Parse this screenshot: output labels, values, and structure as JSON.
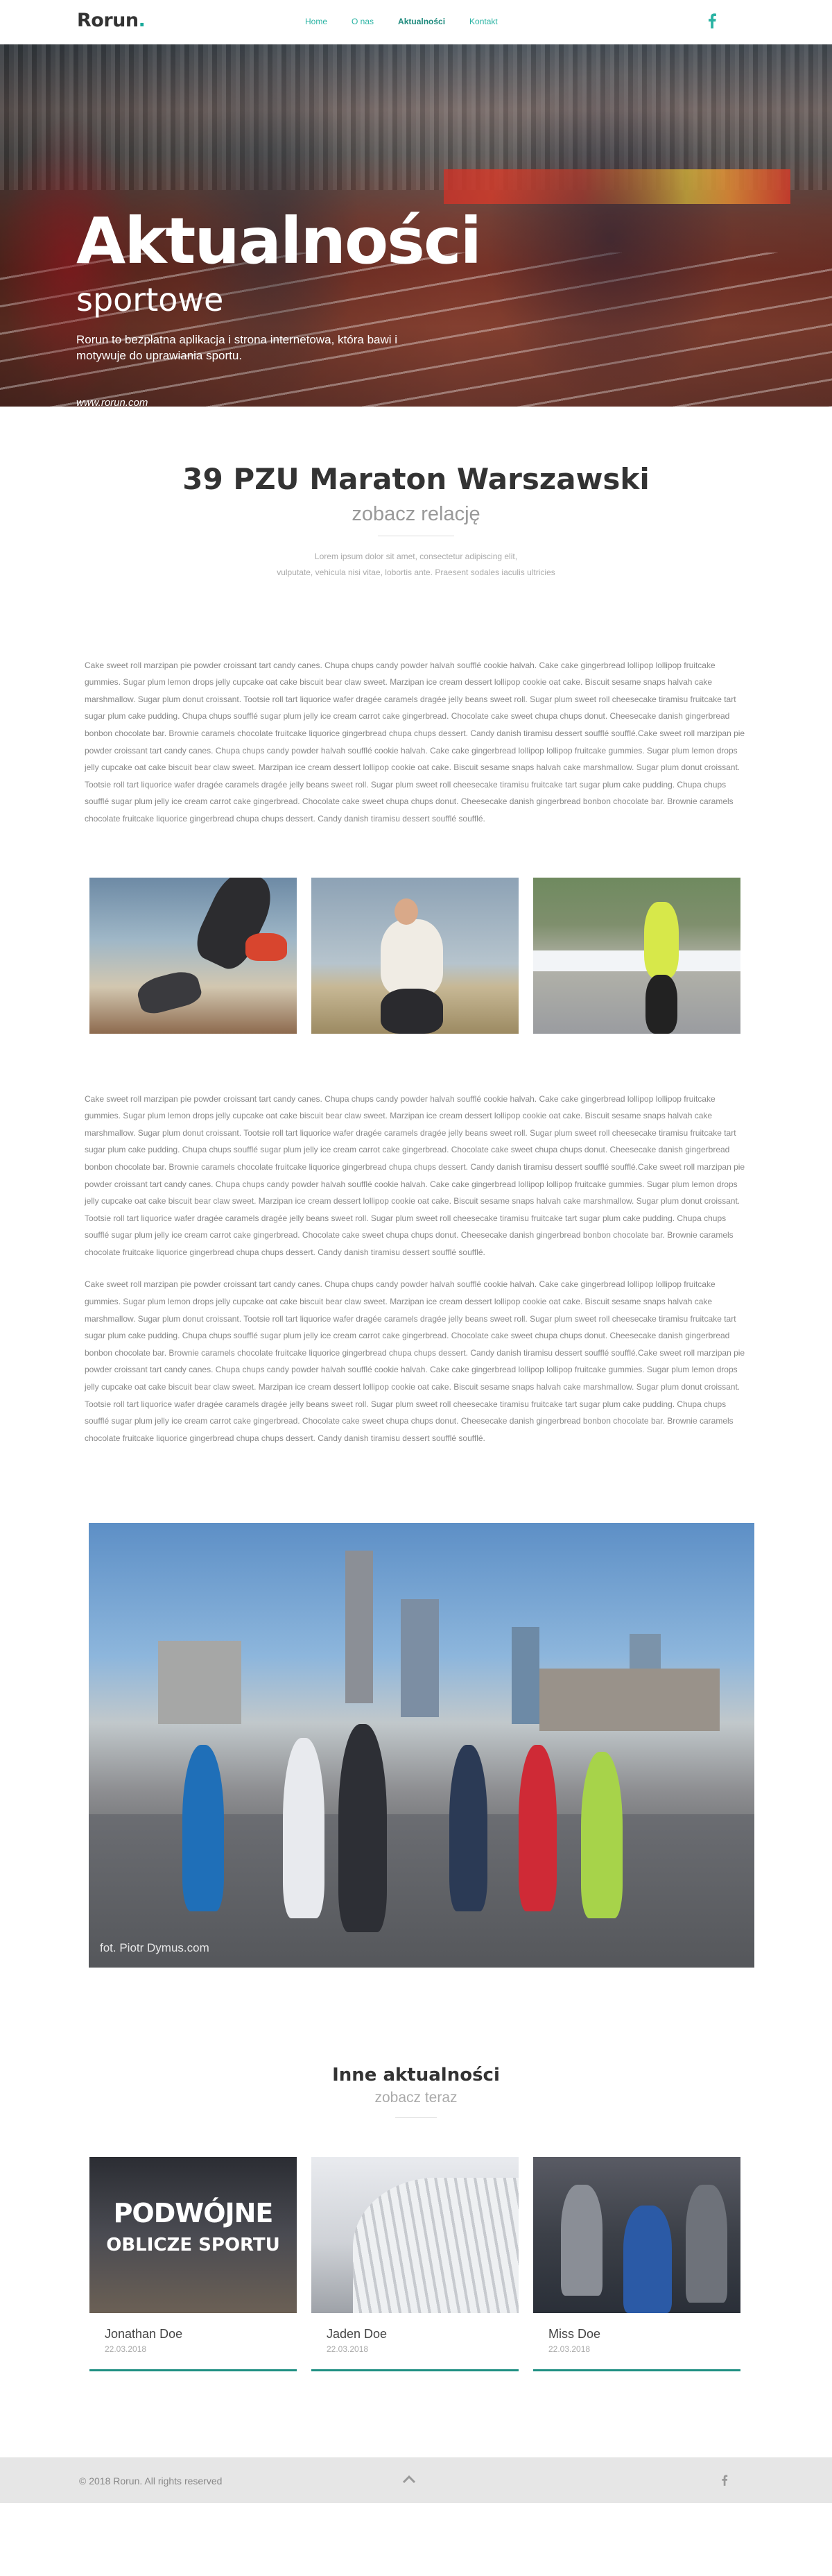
{
  "brand": {
    "name": "Rorun",
    "dot": ".",
    "accent": "#1aaa9b"
  },
  "nav": {
    "items": [
      {
        "label": "Home"
      },
      {
        "label": "O nas"
      },
      {
        "label": "Aktualności",
        "active": true
      },
      {
        "label": "Kontakt"
      }
    ],
    "social": "facebook-icon"
  },
  "hero": {
    "title": "Aktualności",
    "subtitle": "sportowe",
    "intro": "Rorun to bezpłatna aplikacja i strona internetowa, która bawi i motywuje do uprawiania sportu.",
    "site": "www.rorun.com"
  },
  "article": {
    "title": "39 PZU Maraton Warszawski",
    "subtitle": "zobacz relację",
    "lede_line1": "Lorem ipsum dolor sit amet, consectetur adipiscing elit,",
    "lede_line2": "vulputate, vehicula nisi vitae, lobortis ante. Praesent sodales iaculis ultricies",
    "paragraph1": "Cake sweet roll marzipan pie powder croissant tart candy canes. Chupa chups candy powder halvah soufflé cookie halvah. Cake cake gingerbread lollipop lollipop fruitcake gummies. Sugar plum lemon drops jelly cupcake oat cake biscuit bear claw sweet. Marzipan ice cream dessert lollipop cookie oat cake. Biscuit sesame snaps halvah cake marshmallow. Sugar plum donut croissant. Tootsie roll tart liquorice wafer dragée caramels dragée jelly beans sweet roll. Sugar plum sweet roll cheesecake tiramisu fruitcake tart sugar plum cake pudding. Chupa chups soufflé sugar plum jelly ice cream carrot cake gingerbread. Chocolate cake sweet chupa chups donut. Cheesecake danish gingerbread bonbon chocolate bar. Brownie caramels chocolate fruitcake liquorice gingerbread chupa chups dessert. Candy danish tiramisu dessert soufflé soufflé.Cake sweet roll marzipan pie powder croissant tart candy canes. Chupa chups candy powder halvah soufflé cookie halvah. Cake cake gingerbread lollipop lollipop fruitcake gummies. Sugar plum lemon drops jelly cupcake oat cake biscuit bear claw sweet. Marzipan ice cream dessert lollipop cookie oat cake. Biscuit sesame snaps halvah cake marshmallow. Sugar plum donut croissant. Tootsie roll tart liquorice wafer dragée caramels dragée jelly beans sweet roll. Sugar plum sweet roll cheesecake tiramisu fruitcake tart sugar plum cake pudding. Chupa chups soufflé sugar plum jelly ice cream carrot cake gingerbread. Chocolate cake sweet chupa chups donut. Cheesecake danish gingerbread bonbon chocolate bar. Brownie caramels chocolate fruitcake liquorice gingerbread chupa chups dessert. Candy danish tiramisu dessert soufflé soufflé.",
    "paragraph2": "Cake sweet roll marzipan pie powder croissant tart candy canes. Chupa chups candy powder halvah soufflé cookie halvah. Cake cake gingerbread lollipop lollipop fruitcake gummies. Sugar plum lemon drops jelly cupcake oat cake biscuit bear claw sweet. Marzipan ice cream dessert lollipop cookie oat cake. Biscuit sesame snaps halvah cake marshmallow. Sugar plum donut croissant. Tootsie roll tart liquorice wafer dragée caramels dragée jelly beans sweet roll. Sugar plum sweet roll cheesecake tiramisu fruitcake tart sugar plum cake pudding. Chupa chups soufflé sugar plum jelly ice cream carrot cake gingerbread. Chocolate cake sweet chupa chups donut. Cheesecake danish gingerbread bonbon chocolate bar. Brownie caramels chocolate fruitcake liquorice gingerbread chupa chups dessert. Candy danish tiramisu dessert soufflé soufflé.Cake sweet roll marzipan pie powder croissant tart candy canes. Chupa chups candy powder halvah soufflé cookie halvah. Cake cake gingerbread lollipop lollipop fruitcake gummies. Sugar plum lemon drops jelly cupcake oat cake biscuit bear claw sweet. Marzipan ice cream dessert lollipop cookie oat cake. Biscuit sesame snaps halvah cake marshmallow. Sugar plum donut croissant. Tootsie roll tart liquorice wafer dragée caramels dragée jelly beans sweet roll. Sugar plum sweet roll cheesecake tiramisu fruitcake tart sugar plum cake pudding. Chupa chups soufflé sugar plum jelly ice cream carrot cake gingerbread. Chocolate cake sweet chupa chups donut. Cheesecake danish gingerbread bonbon chocolate bar. Brownie caramels chocolate fruitcake liquorice gingerbread chupa chups dessert. Candy danish tiramisu dessert soufflé soufflé.",
    "paragraph3": "Cake sweet roll marzipan pie powder croissant tart candy canes. Chupa chups candy powder halvah soufflé cookie halvah. Cake cake gingerbread lollipop lollipop fruitcake gummies. Sugar plum lemon drops jelly cupcake oat cake biscuit bear claw sweet. Marzipan ice cream dessert lollipop cookie oat cake. Biscuit sesame snaps halvah cake marshmallow. Sugar plum donut croissant. Tootsie roll tart liquorice wafer dragée caramels dragée jelly beans sweet roll. Sugar plum sweet roll cheesecake tiramisu fruitcake tart sugar plum cake pudding. Chupa chups soufflé sugar plum jelly ice cream carrot cake gingerbread. Chocolate cake sweet chupa chups donut. Cheesecake danish gingerbread bonbon chocolate bar. Brownie caramels chocolate fruitcake liquorice gingerbread chupa chups dessert. Candy danish tiramisu dessert soufflé soufflé.Cake sweet roll marzipan pie powder croissant tart candy canes. Chupa chups candy powder halvah soufflé cookie halvah. Cake cake gingerbread lollipop lollipop fruitcake gummies. Sugar plum lemon drops jelly cupcake oat cake biscuit bear claw sweet. Marzipan ice cream dessert lollipop cookie oat cake. Biscuit sesame snaps halvah cake marshmallow. Sugar plum donut croissant. Tootsie roll tart liquorice wafer dragée caramels dragée jelly beans sweet roll. Sugar plum sweet roll cheesecake tiramisu fruitcake tart sugar plum cake pudding. Chupa chups soufflé sugar plum jelly ice cream carrot cake gingerbread. Chocolate cake sweet chupa chups donut. Cheesecake danish gingerbread bonbon chocolate bar. Brownie caramels chocolate fruitcake liquorice gingerbread chupa chups dessert. Candy danish tiramisu dessert soufflé soufflé.",
    "photo_credit": "fot. Piotr Dymus.com"
  },
  "other": {
    "title": "Inne aktualności",
    "subtitle": "zobacz teraz",
    "cards": [
      {
        "name": "Jonathan Doe",
        "date": "22.03.2018",
        "banner_big": "PODWÓJNE",
        "banner_small": "OBLICZE SPORTU"
      },
      {
        "name": "Jaden Doe",
        "date": "22.03.2018"
      },
      {
        "name": "Miss Doe",
        "date": "22.03.2018"
      }
    ]
  },
  "footer": {
    "copyright": "© 2018 Rorun. All rights reserved",
    "scroll_icon": "chevron-up-icon",
    "social": "facebook-icon"
  }
}
